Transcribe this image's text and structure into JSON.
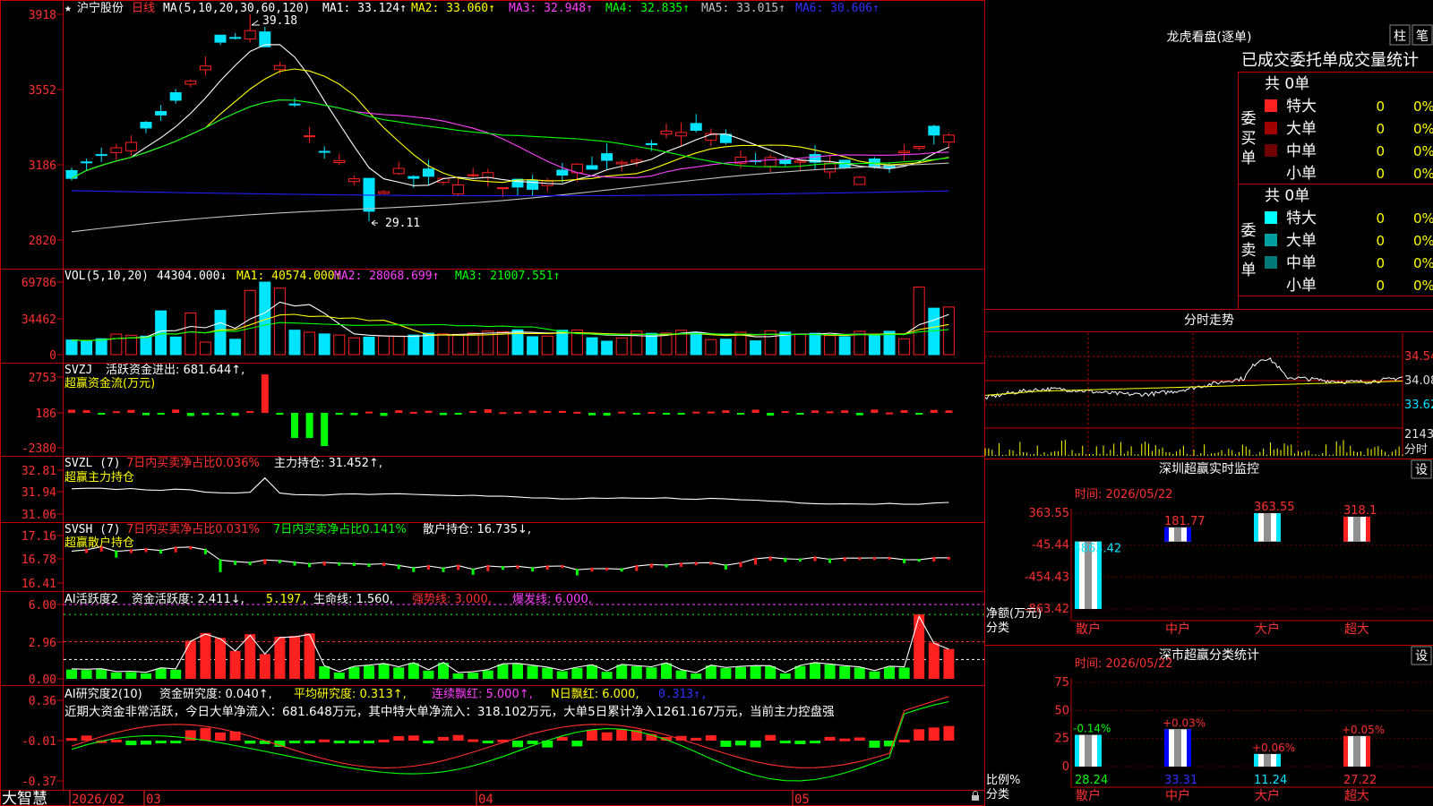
{
  "colors": {
    "up": "#ff2020",
    "down": "#00e5ff",
    "frame": "#c00000",
    "text": "#e0e0e0",
    "yellow": "#ffff00",
    "white": "#ffffff",
    "magenta": "#ff40ff",
    "green": "#00ff00",
    "blue": "#2020ff",
    "grey": "#c0c0c0"
  },
  "header": {
    "star": "★",
    "stock": "沪宁股份",
    "period": "日线",
    "ma_params": "MA(5,10,20,30,60,120)",
    "ma": [
      {
        "text": "MA1: 33.124↑",
        "color": "#ffffff"
      },
      {
        "text": "MA2: 33.060↑",
        "color": "#ffff00"
      },
      {
        "text": "MA3: 32.948↑",
        "color": "#ff40ff"
      },
      {
        "text": "MA4: 32.835↑",
        "color": "#00ff00"
      },
      {
        "text": "MA5: 33.015↑",
        "color": "#c0c0c0"
      },
      {
        "text": "MA6: 30.606↑",
        "color": "#3030ff"
      }
    ],
    "high_mark": "39.18",
    "low_mark": "29.11"
  },
  "price_axis": [
    "3918",
    "3552",
    "3186",
    "2820"
  ],
  "vol": {
    "title": "VOL(5,10,20)",
    "items": [
      {
        "text": "44304.000↓",
        "color": "#ffffff"
      },
      {
        "text": "MA1: 40574.000↑",
        "color": "#ffff00"
      },
      {
        "text": "MA2: 28068.699↑",
        "color": "#ff40ff"
      },
      {
        "text": "MA3: 21007.551↑",
        "color": "#00ff00"
      }
    ],
    "axis": [
      "69786",
      "34462",
      "0"
    ]
  },
  "svzj": {
    "title": "SVZJ",
    "label": "活跃资金进出: 681.644↑,",
    "sub": "超赢资金流(万元)",
    "axis": [
      "2753",
      "186",
      "-2380"
    ]
  },
  "svzl": {
    "title": "SVZL (7)",
    "net": "7日内买卖净占比0.036%",
    "pos": "主力持仓: 31.452↑,",
    "sub": "超赢主力持仓",
    "axis": [
      "32.81",
      "31.94",
      "31.06"
    ]
  },
  "svsh": {
    "title": "SVSH (7)",
    "net1": "7日内买卖净占比0.031%",
    "net2": "7日内买卖净占比0.141%",
    "pos": "散户持仓: 16.735↓,",
    "sub": "超赢散户持仓",
    "axis": [
      "17.16",
      "16.78",
      "16.41"
    ]
  },
  "ai1": {
    "title": "AI活跃度2",
    "v1": "资金活跃度: 2.411↓,",
    "v2": "5.197,",
    "v3": "生命线: 1.560,",
    "v4": "强势线: 3.000,",
    "v5": "爆发线: 6.000,",
    "axis": [
      "6.00",
      "2.96",
      "0.00"
    ]
  },
  "ai2": {
    "title": "AI研究度2(10)",
    "v1": "资金研究度: 0.040↑,",
    "v2": "平均研究度: 0.313↑,",
    "v3": "连续飘红: 5.000↑,",
    "v4": "N日飘红: 6.000,",
    "v5": "0.313↑,",
    "comment": "近期大资金非常活跃，今日大单净流入：681.648万元，其中特大单净流入：318.102万元，大单5日累计净入1261.167万元，当前主力控盘强",
    "axis": [
      "0.36",
      "-0.01",
      "-0.37"
    ]
  },
  "xaxis": {
    "brand": "大智慧",
    "labels": [
      "2026/02",
      "03",
      "04",
      "05"
    ]
  },
  "lhb": {
    "title": "龙虎看盘(逐单)",
    "btn_zhu": "柱",
    "btn_bi": "笔",
    "subtitle": "已成交委托单成交量统计",
    "buy_label": "委买单",
    "sell_label": "委卖单",
    "buy_total": "共 0单",
    "sell_total": "共 0单",
    "buy_rows": [
      {
        "name": "特大",
        "val": "0",
        "pct": "0%",
        "color": "#ff2020"
      },
      {
        "name": "大单",
        "val": "0",
        "pct": "0%",
        "color": "#a00000"
      },
      {
        "name": "中单",
        "val": "0",
        "pct": "0%",
        "color": "#700000"
      },
      {
        "name": "小单",
        "val": "0",
        "pct": "0%",
        "color": "#000000"
      }
    ],
    "sell_rows": [
      {
        "name": "特大",
        "val": "0",
        "pct": "0%",
        "color": "#00ffff"
      },
      {
        "name": "大单",
        "val": "0",
        "pct": "0%",
        "color": "#00a0a0"
      },
      {
        "name": "中单",
        "val": "0",
        "pct": "0%",
        "color": "#007878"
      },
      {
        "name": "小单",
        "val": "0",
        "pct": "0%",
        "color": "#000000"
      }
    ]
  },
  "intraday": {
    "title": "分时走势",
    "axis": [
      "34.54",
      "34.08",
      "33.62"
    ],
    "vol_axis": "2143",
    "vol_unit": "分时"
  },
  "sz_monitor": {
    "title": "深圳超赢实时监控",
    "btn": "设",
    "time": "时间: 2026/05/22",
    "axis": [
      "363.55",
      "-45.44",
      "-454.43",
      "-863.42"
    ],
    "ylabel1": "净额(万元)",
    "ylabel2": "分类",
    "bars": [
      {
        "cat": "散户",
        "value": -863.42,
        "label": "-863.42"
      },
      {
        "cat": "中户",
        "value": 181.77,
        "label": "181.77"
      },
      {
        "cat": "大户",
        "value": 363.55,
        "label": "363.55"
      },
      {
        "cat": "超大",
        "value": 318.1,
        "label": "318.1"
      }
    ]
  },
  "sz_stat": {
    "title": "深市超赢分类统计",
    "btn": "设",
    "time": "时间: 2026/05/22",
    "axis": [
      "75",
      "50",
      "25",
      "0"
    ],
    "ylabel1": "比例%",
    "ylabel2": "分类",
    "bars": [
      {
        "cat": "散户",
        "value": 28.24,
        "label": "28.24",
        "change": "-0.14%"
      },
      {
        "cat": "中户",
        "value": 33.31,
        "label": "33.31",
        "change": "+0.03%"
      },
      {
        "cat": "大户",
        "value": 11.24,
        "label": "11.24",
        "change": "+0.06%"
      },
      {
        "cat": "超大",
        "value": 27.22,
        "label": "27.22",
        "change": "+0.05%"
      }
    ]
  }
}
